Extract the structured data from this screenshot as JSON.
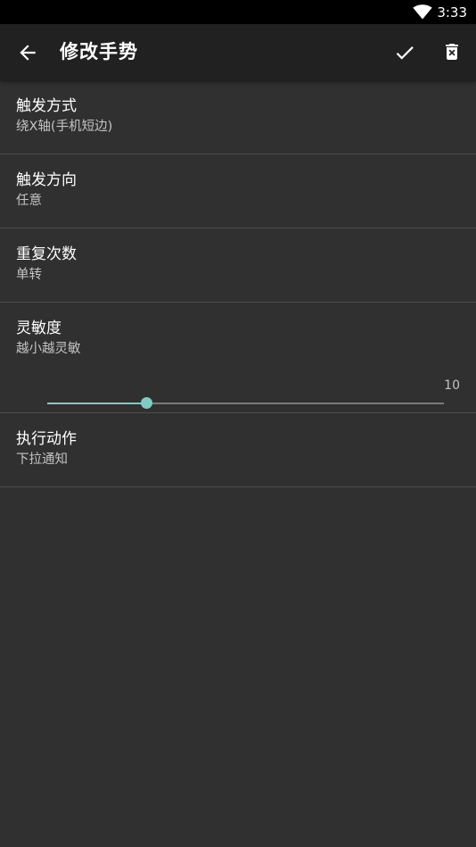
{
  "status_bar": {
    "time": "3:33",
    "icons": [
      "wifi-icon"
    ]
  },
  "toolbar": {
    "title": "修改手势",
    "icons": [
      "arrow-back-icon",
      "check-icon",
      "trash-icon"
    ]
  },
  "settings": [
    {
      "title": "触发方式",
      "summary": "绕X轴(手机短边)"
    },
    {
      "title": "触发方向",
      "summary": "任意"
    },
    {
      "title": "重复次数",
      "summary": "单转"
    },
    {
      "title": "灵敏度",
      "summary": "越小越灵敏",
      "value": "10",
      "level": 0.25
    },
    {
      "title": "执行动作",
      "summary": "下拉通知"
    }
  ],
  "colors": {
    "background": "#303030",
    "toolbar": "#212121",
    "status_bar": "#000000",
    "accent": "#80cbc4",
    "divider": "#4c4c4c",
    "secondary_text": "#c4c4c4"
  }
}
